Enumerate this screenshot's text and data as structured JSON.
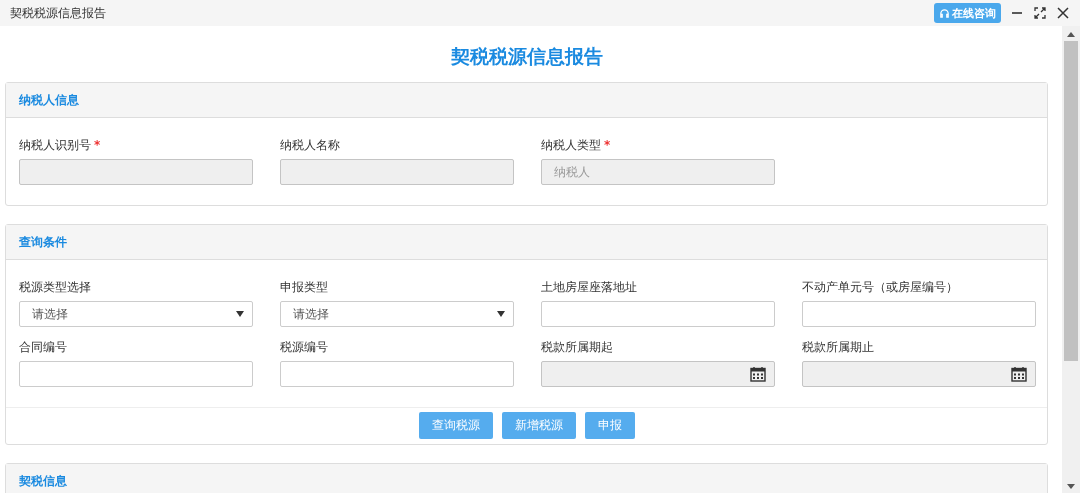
{
  "window": {
    "title": "契税税源信息报告",
    "consult_button": "在线咨询"
  },
  "page_title": "契税税源信息报告",
  "panels": [
    {
      "title": "纳税人信息",
      "fields": [
        {
          "label": "纳税人识别号",
          "kind": "text",
          "required_mark": "*",
          "disabled": true
        },
        {
          "label": "纳税人名称",
          "kind": "text",
          "disabled": true
        },
        {
          "label": "纳税人类型",
          "kind": "text",
          "required_mark": "*",
          "disabled": true,
          "placeholder": "纳税人"
        }
      ]
    },
    {
      "title": "查询条件",
      "fields": [
        {
          "label": "税源类型选择",
          "kind": "select",
          "disabled": false,
          "value": "请选择"
        },
        {
          "label": "申报类型",
          "kind": "select",
          "disabled": false,
          "value": "请选择"
        },
        {
          "label": "土地房屋座落地址",
          "kind": "text",
          "disabled": false
        },
        {
          "label": "不动产单元号（或房屋编号）",
          "kind": "text",
          "disabled": false
        },
        {
          "label": "合同编号",
          "kind": "text",
          "disabled": false
        },
        {
          "label": "税源编号",
          "kind": "text",
          "disabled": false
        },
        {
          "label": "税款所属期起",
          "kind": "date",
          "disabled": true
        },
        {
          "label": "税款所属期止",
          "kind": "date",
          "disabled": true
        }
      ],
      "buttons": [
        "查询税源",
        "新增税源",
        "申报"
      ]
    },
    {
      "title": "契税信息"
    }
  ]
}
